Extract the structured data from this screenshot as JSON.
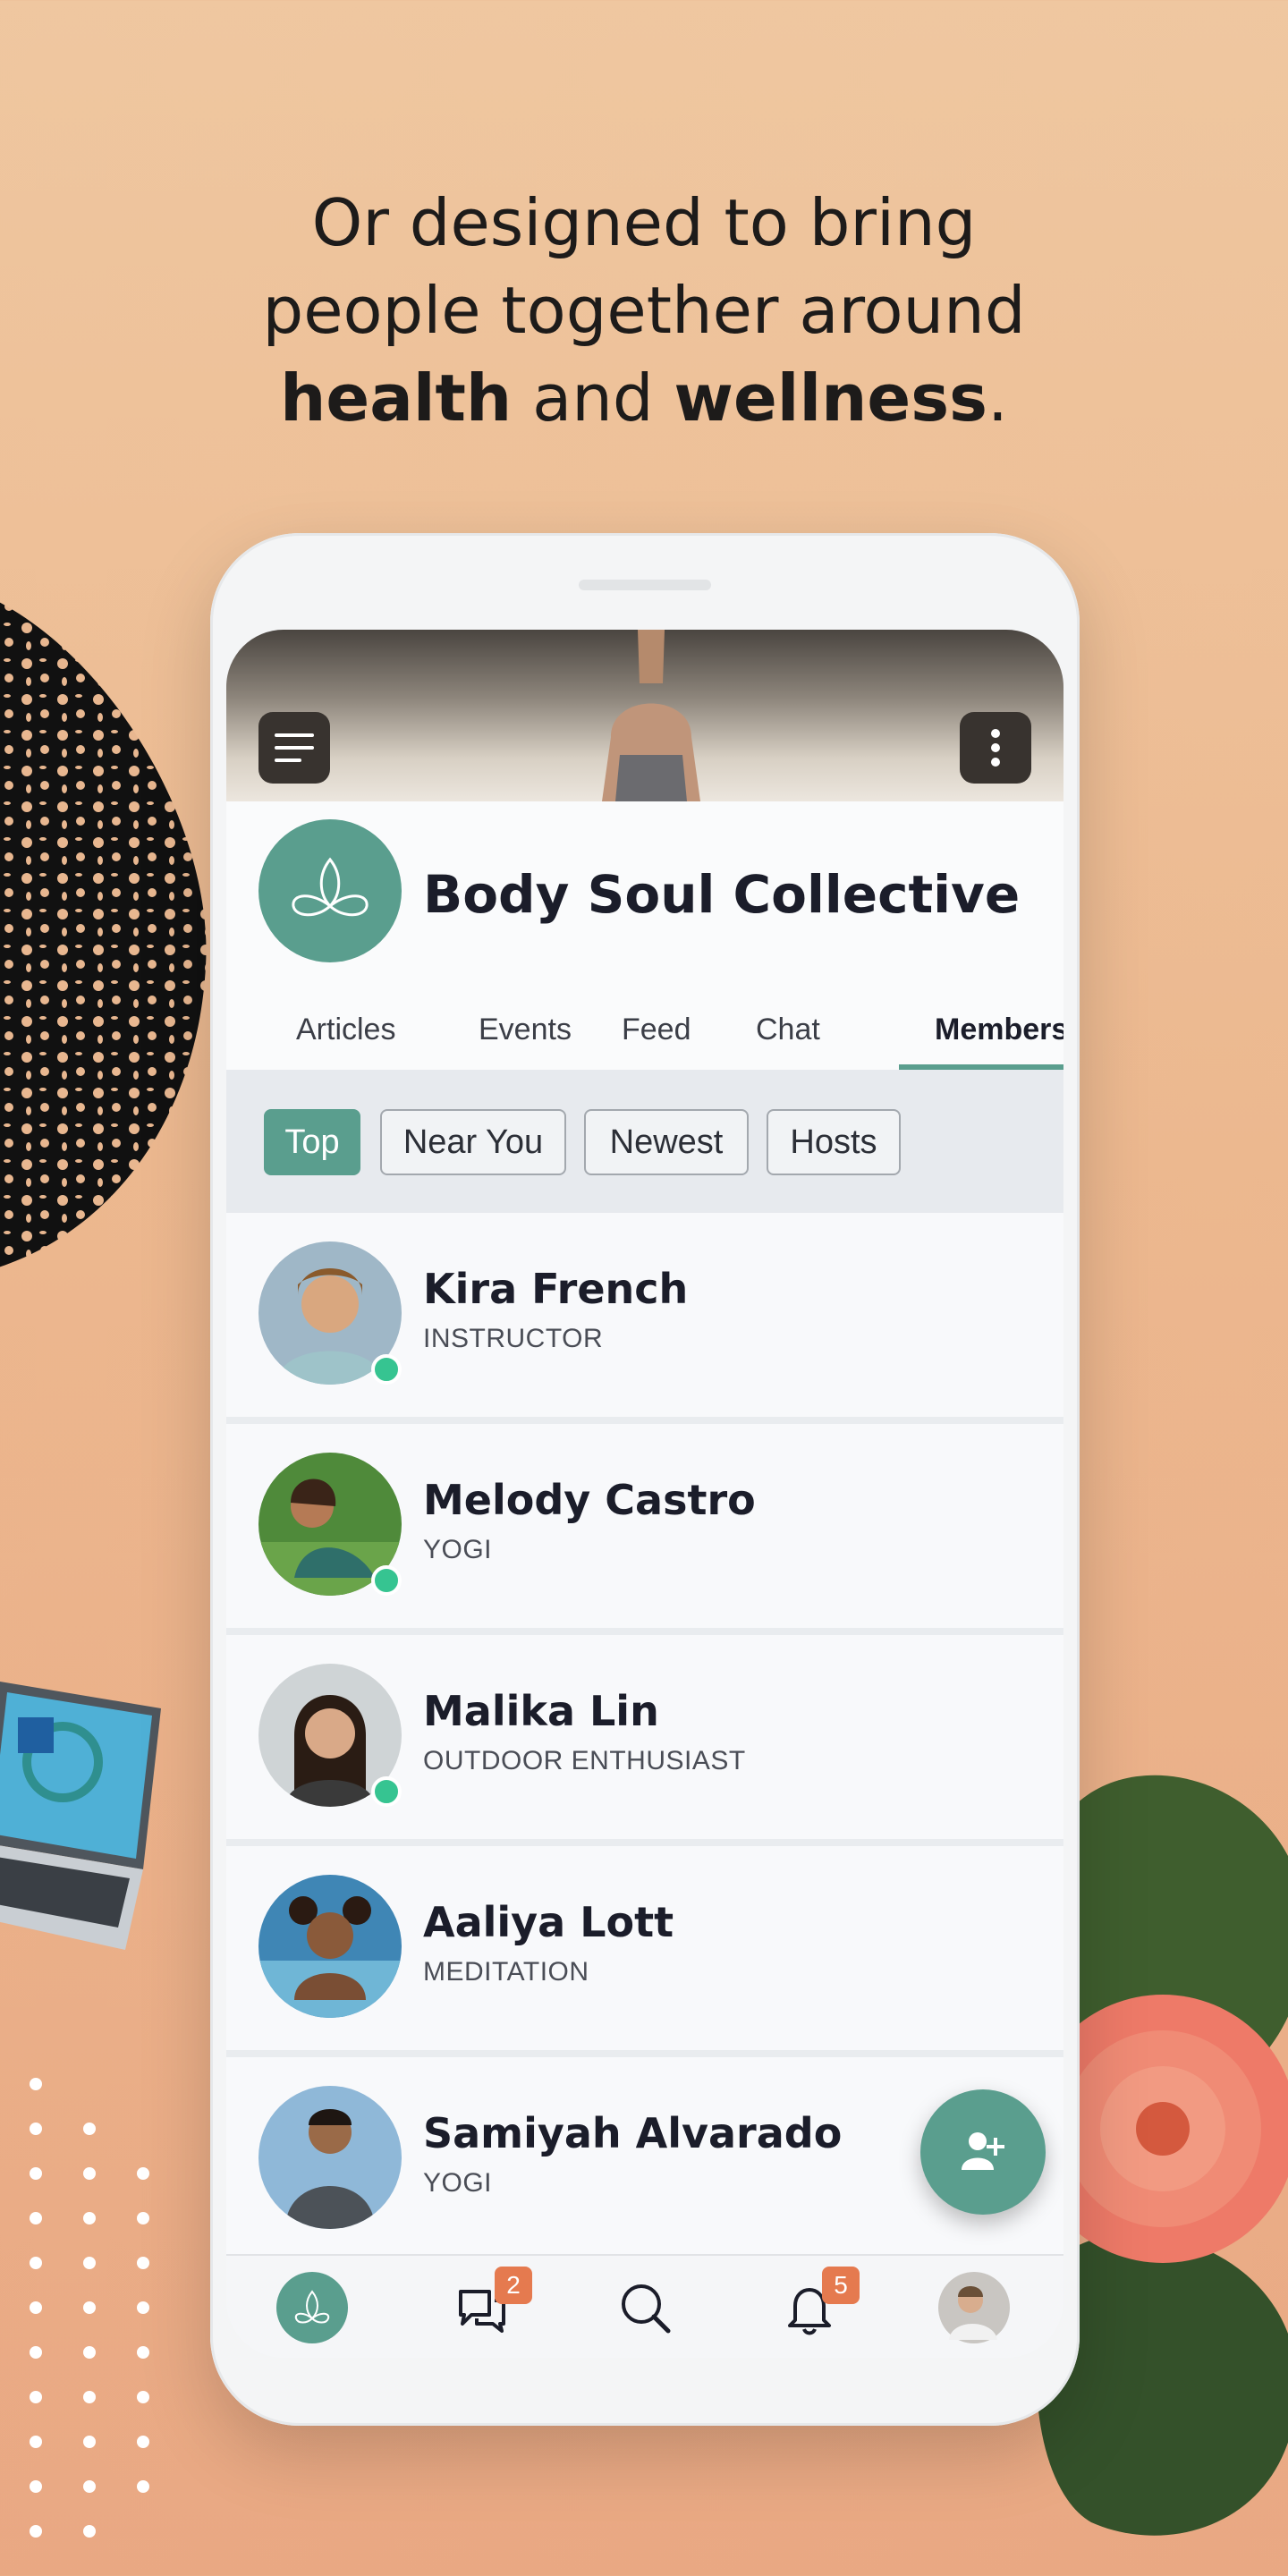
{
  "headline": {
    "line1": "Or designed to bring",
    "line2": "people together around",
    "bold1": "health",
    "mid": " and ",
    "bold2": "wellness",
    "end": "."
  },
  "app": {
    "community_name": "Body Soul Collective",
    "brand_color": "#5a9e8e",
    "tabs": [
      {
        "label": "Articles",
        "active": false
      },
      {
        "label": "Events",
        "active": false
      },
      {
        "label": "Feed",
        "active": false
      },
      {
        "label": "Chat",
        "active": false
      },
      {
        "label": "Members",
        "active": true
      }
    ],
    "filters": [
      {
        "label": "Top",
        "active": true
      },
      {
        "label": "Near You",
        "active": false
      },
      {
        "label": "Newest",
        "active": false
      },
      {
        "label": "Hosts",
        "active": false
      }
    ],
    "members": [
      {
        "name": "Kira French",
        "role": "INSTRUCTOR",
        "online": true
      },
      {
        "name": "Melody Castro",
        "role": "YOGI",
        "online": true
      },
      {
        "name": "Malika Lin",
        "role": "OUTDOOR ENTHUSIAST",
        "online": true
      },
      {
        "name": "Aaliya Lott",
        "role": "MEDITATION",
        "online": false
      },
      {
        "name": "Samiyah Alvarado",
        "role": "YOGI",
        "online": false
      }
    ],
    "bottom_nav": {
      "chat_badge": "2",
      "notifications_badge": "5"
    },
    "icons": {
      "menu": "menu-icon",
      "more": "more-vertical-icon",
      "fab": "add-person-icon",
      "home": "community-home-icon",
      "chat": "chat-bubbles-icon",
      "search": "search-icon",
      "notifications": "bell-icon",
      "profile": "profile-avatar"
    },
    "status_colors": {
      "online": "#36c491",
      "badge": "#e57a4f"
    }
  }
}
